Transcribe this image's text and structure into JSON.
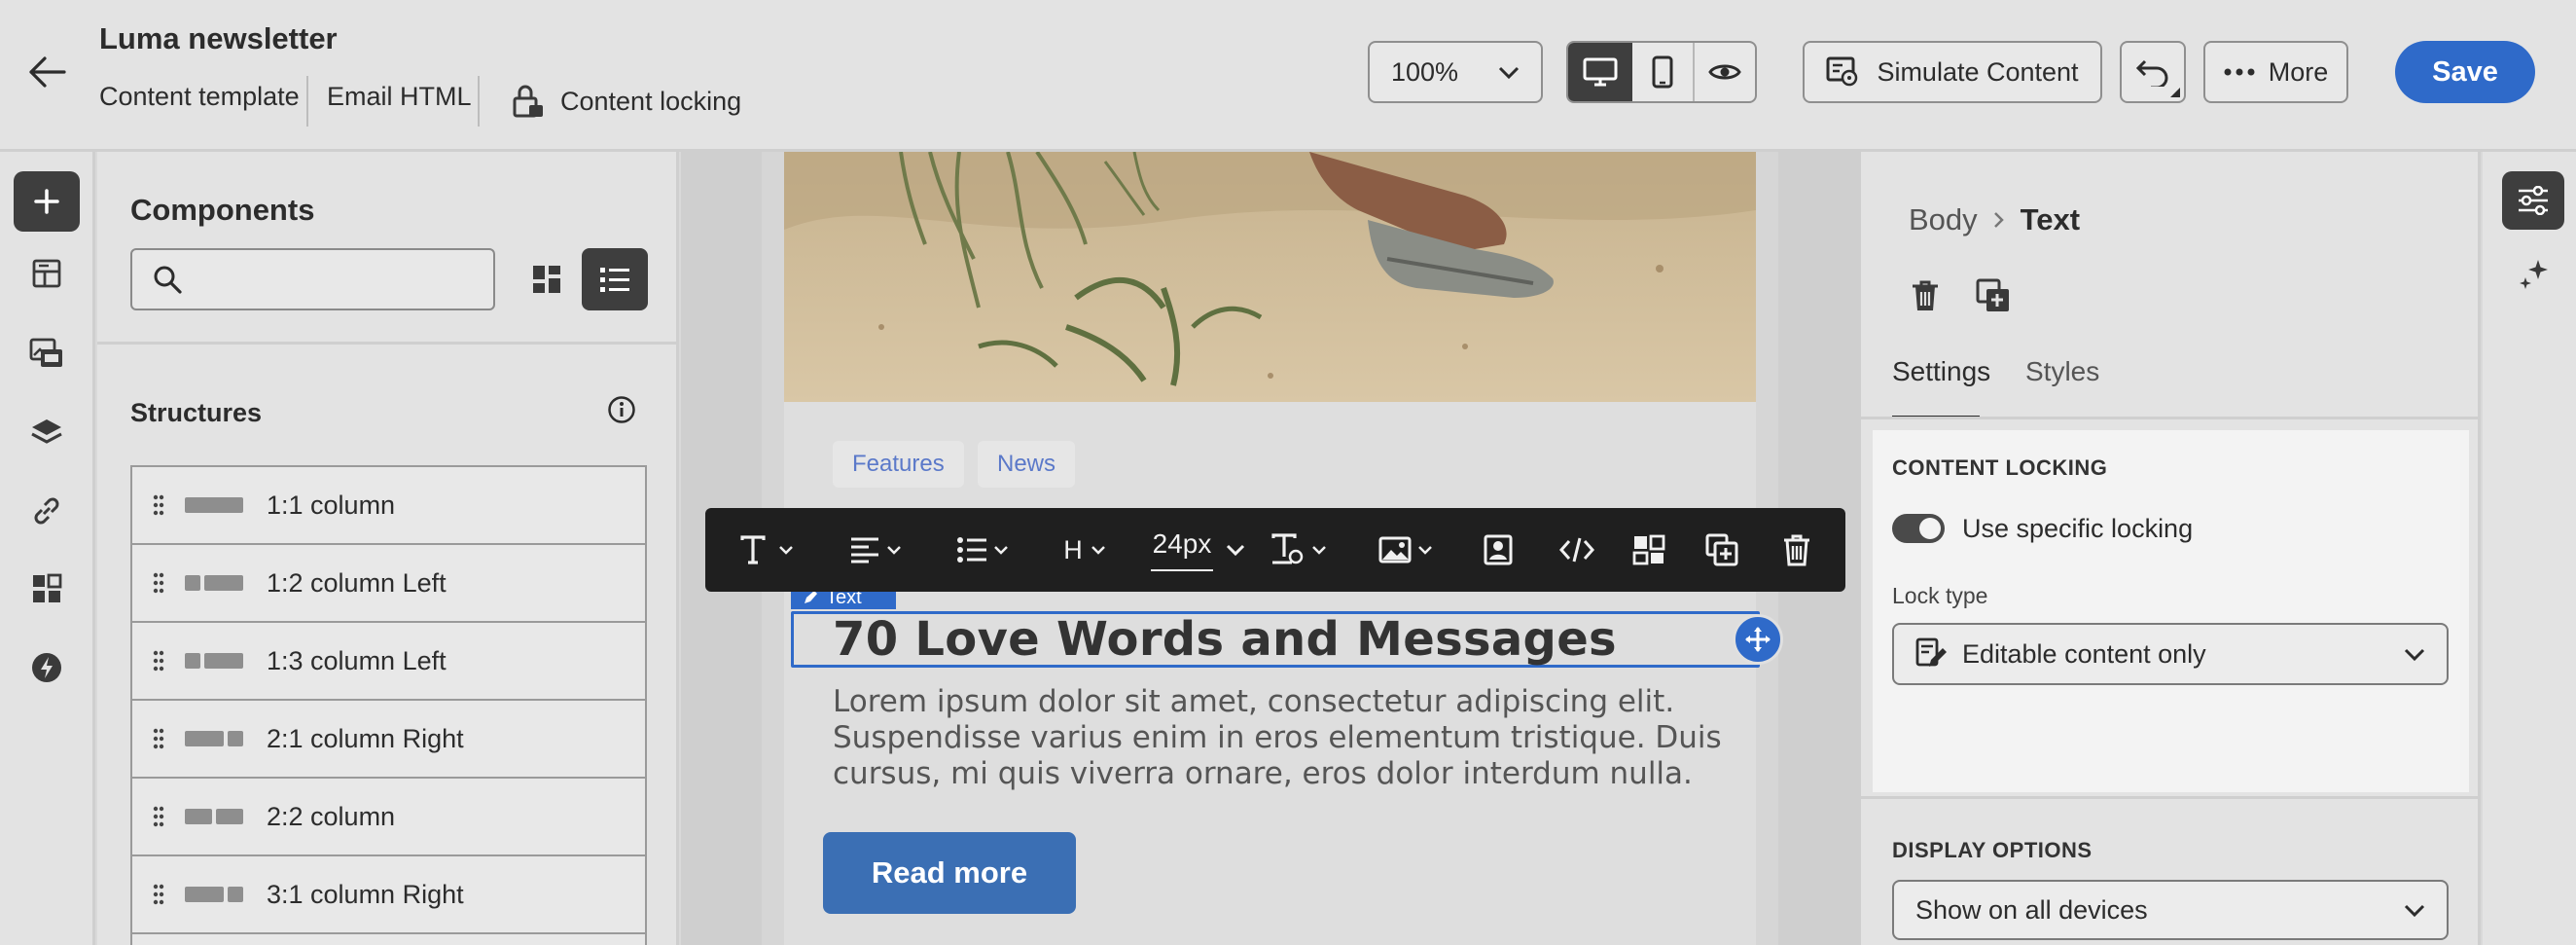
{
  "header": {
    "title": "Luma newsletter",
    "tabs": [
      {
        "label": "Content template"
      },
      {
        "label": "Email HTML"
      }
    ],
    "content_locking_label": "Content locking",
    "zoom": "100%",
    "simulate_label": "Simulate Content",
    "more_label": "More",
    "save_label": "Save"
  },
  "rail_icons": [
    "plus-icon",
    "fragments-icon",
    "assets-icon",
    "layers-icon",
    "link-icon",
    "components-grid-icon",
    "lightning-icon"
  ],
  "components": {
    "title": "Components",
    "search": {
      "value": "",
      "placeholder": ""
    },
    "structures_title": "Structures",
    "structures": [
      {
        "label": "1:1 column"
      },
      {
        "label": "1:2 column Left"
      },
      {
        "label": "1:3 column Left"
      },
      {
        "label": "2:1 column Right"
      },
      {
        "label": "2:2 column"
      },
      {
        "label": "3:1 column Right"
      }
    ]
  },
  "email": {
    "tags": [
      "Features",
      "News"
    ],
    "selected_tag": "Text",
    "heading": "70 Love Words and Messages",
    "body_lines": [
      "Lorem ipsum dolor sit amet, consectetur adipiscing elit.",
      "Suspendisse varius enim in eros elementum tristique. Duis",
      "cursus, mi quis viverra ornare, eros dolor interdum nulla."
    ],
    "cta_label": "Read more"
  },
  "toolbar": {
    "heading_level": "H",
    "font_size": "24px"
  },
  "props": {
    "breadcrumb": {
      "parent": "Body",
      "current": "Text"
    },
    "tabs": [
      {
        "label": "Settings"
      },
      {
        "label": "Styles"
      }
    ],
    "content_locking": {
      "section_title": "CONTENT LOCKING",
      "toggle_label": "Use specific locking",
      "toggle_on": true,
      "lock_type_label": "Lock type",
      "lock_type_value": "Editable content only"
    },
    "display_options": {
      "section_title": "DISPLAY OPTIONS",
      "value": "Show on all devices"
    }
  },
  "colors": {
    "accent": "#2f6ac9",
    "toolbar_bg": "#1f1f1f",
    "tag_text": "#5b79c9",
    "selection": "#2f6ac9"
  }
}
